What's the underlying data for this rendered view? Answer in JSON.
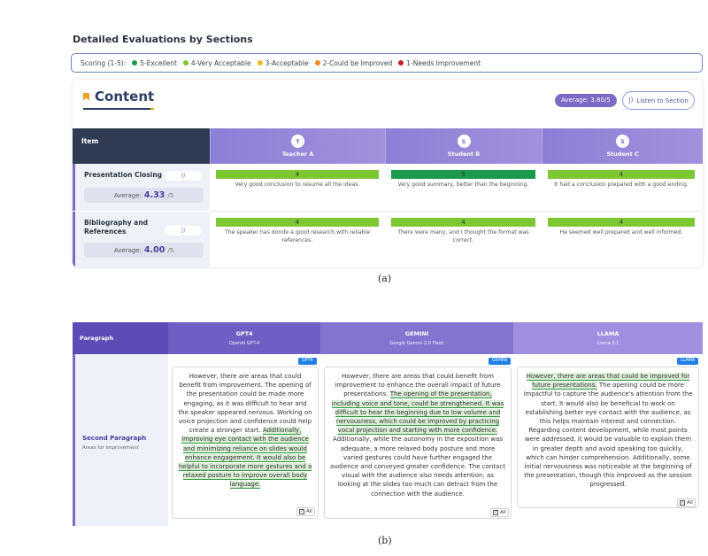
{
  "section_title": "Detailed Evaluations by Sections",
  "legend": {
    "prefix": "Scoring (1-5):",
    "items": [
      {
        "label": "5-Excellent",
        "color": "#1a9a4a"
      },
      {
        "label": "4-Very Acceptable",
        "color": "#7cc732"
      },
      {
        "label": "3-Acceptable",
        "color": "#f0b62a"
      },
      {
        "label": "2-Could be Improved",
        "color": "#f08a24"
      },
      {
        "label": "1-Needs Improvement",
        "color": "#c81e2e"
      }
    ]
  },
  "content": {
    "title": "Content",
    "average_badge": "Average: 3.80/5",
    "listen_label": "Listen to Section",
    "item_header": "Item",
    "evaluators": [
      {
        "initial": "T",
        "name": "Teacher A"
      },
      {
        "initial": "S",
        "name": "Student B"
      },
      {
        "initial": "S",
        "name": "Student C"
      }
    ],
    "rows": [
      {
        "name": "Presentation Closing",
        "avg_label": "Average:",
        "avg_value": "4.33",
        "avg_unit": "/5",
        "scores": [
          {
            "value": "4",
            "color": "#7cc732",
            "comment": "Very good conclusion to resume all the ideas."
          },
          {
            "value": "5",
            "color": "#1a9a4a",
            "comment": "Very good summary, better than the beginning."
          },
          {
            "value": "4",
            "color": "#7cc732",
            "comment": "It had a conclusion prepared with a good ending."
          }
        ]
      },
      {
        "name": "Bibliography and References",
        "avg_label": "Average:",
        "avg_value": "4.00",
        "avg_unit": "/5",
        "scores": [
          {
            "value": "4",
            "color": "#7cc732",
            "comment": "The speaker has donde a good research with reliable references."
          },
          {
            "value": "4",
            "color": "#7cc732",
            "comment": "There were many, and I thought the format was correct."
          },
          {
            "value": "4",
            "color": "#7cc732",
            "comment": "He seemed well prepared and well informed."
          }
        ]
      }
    ]
  },
  "caption_a": "(a)",
  "caption_b": "(b)",
  "comparison": {
    "paragraph_header": "Paragraph",
    "row_title": "Second Paragraph",
    "row_subtitle": "Areas for improvement",
    "all_label": "All",
    "models": [
      {
        "name": "GPT4",
        "subtitle": "OpenAI GPT-4",
        "tag": "GPT4",
        "segments": [
          {
            "text": "However, there are areas that could benefit from improvement.  The opening of the presentation could be made more engaging, as it was difficult to hear and the speaker appeared nervous.  Working on voice projection and confidence could help create a stronger start.  ",
            "hl": false
          },
          {
            "text": "Additionally, improving eye contact with the audience and minimizing reliance on slides would enhance engagement.  It would also be helpful to incorporate more gestures and a relaxed posture to improve overall body language.",
            "hl": true
          }
        ]
      },
      {
        "name": "GEMINI",
        "subtitle": "Google Gemini 2.0 Flash",
        "tag": "GEMINI",
        "segments": [
          {
            "text": "However, there are areas that could benefit from improvement to enhance the overall impact of future presentations.  ",
            "hl": false
          },
          {
            "text": "The opening of the presentation, including voice and tone, could be strengthened.  It was difficult to hear the beginning due to low volume and nervousness, which could be improved by practicing vocal projection and starting with more confidence.",
            "hl": true
          },
          {
            "text": "  Additionally, while the autonomy in the exposition was adequate, a more relaxed body posture and more varied gestures could have further engaged the audience and conveyed greater confidence.  The contact visual with the audience also needs attention, as looking at the slides too much can detract from the connection with the audience.",
            "hl": false
          }
        ]
      },
      {
        "name": "LLAMA",
        "subtitle": "Llama 3.1",
        "tag": "LLAMA",
        "segments": [
          {
            "text": "However, there are areas that could be improved for future presentations.",
            "hl": true
          },
          {
            "text": "  The opening could be more impactful to capture the audience's attention from the start.  It would also be beneficial to work on establishing better eye contact with the audience, as this helps maintain interest and connection.  Regarding content development, while most points were addressed, it would be valuable to explain them in greater depth and avoid speaking too quickly, which can hinder comprehension.  Additionally, some initial nervousness was noticeable at the beginning of the presentation, though this improved as the session progressed.",
            "hl": false
          }
        ]
      }
    ]
  }
}
